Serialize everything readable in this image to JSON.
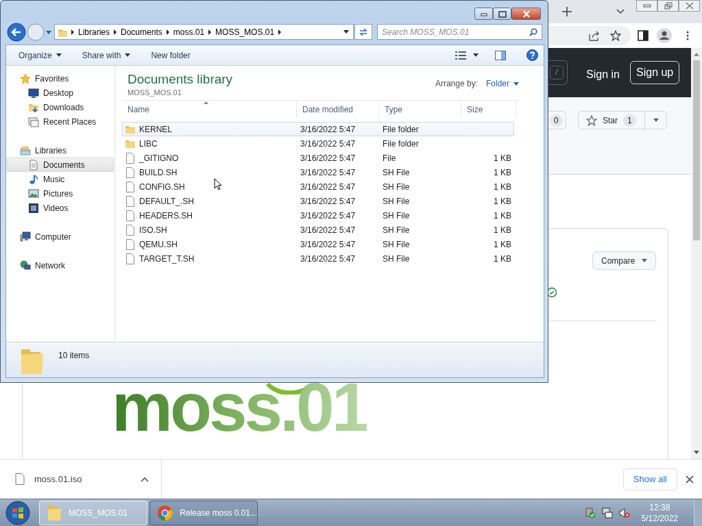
{
  "browser": {
    "header": {
      "slash_key": "/",
      "sign_in": "Sign in",
      "sign_up": "Sign up"
    },
    "watch_count": "0",
    "star_label": "Star",
    "star_count": "1",
    "compare": "Compare",
    "logo": "moss.01"
  },
  "explorer": {
    "address": [
      "Libraries",
      "Documents",
      "moss.01",
      "MOSS_MOS.01"
    ],
    "search_placeholder": "Search MOSS_MOS.01",
    "toolbar": [
      {
        "label": "Organize",
        "dropdown": true
      },
      {
        "label": "Share with",
        "dropdown": true
      },
      {
        "label": "New folder",
        "dropdown": false
      }
    ],
    "nav": [
      {
        "label": "Favorites",
        "selected": false,
        "children": [
          {
            "label": "Desktop",
            "selected": false
          },
          {
            "label": "Downloads",
            "selected": false
          },
          {
            "label": "Recent Places",
            "selected": false
          }
        ]
      },
      {
        "label": "Libraries",
        "selected": false,
        "children": [
          {
            "label": "Documents",
            "selected": true
          },
          {
            "label": "Music",
            "selected": false
          },
          {
            "label": "Pictures",
            "selected": false
          },
          {
            "label": "Videos",
            "selected": false
          }
        ]
      },
      {
        "label": "Computer",
        "selected": false
      },
      {
        "label": "Network",
        "selected": false
      }
    ],
    "library_title": "Documents library",
    "library_subtitle": "MOSS_MOS.01",
    "arrange_label": "Arrange by:",
    "arrange_value": "Folder",
    "columns": [
      "Name",
      "Date modified",
      "Type",
      "Size"
    ],
    "rows": [
      {
        "name": "KERNEL",
        "kind": "folder",
        "date": "3/16/2022 5:47",
        "type": "File folder",
        "selected": true
      },
      {
        "name": "LIBC",
        "kind": "folder",
        "date": "3/16/2022 5:47",
        "type": "File folder",
        "selected": false
      },
      {
        "name": "_GITIGNO",
        "kind": "file",
        "date": "3/16/2022 5:47",
        "type": "File",
        "size": "1 KB",
        "selected": false
      },
      {
        "name": "BUILD.SH",
        "kind": "file",
        "date": "3/16/2022 5:47",
        "type": "SH File",
        "size": "1 KB",
        "selected": false
      },
      {
        "name": "CONFIG.SH",
        "kind": "file",
        "date": "3/16/2022 5:47",
        "type": "SH File",
        "size": "1 KB",
        "selected": false
      },
      {
        "name": "DEFAULT_.SH",
        "kind": "file",
        "date": "3/16/2022 5:47",
        "type": "SH File",
        "size": "1 KB",
        "selected": false
      },
      {
        "name": "HEADERS.SH",
        "kind": "file",
        "date": "3/16/2022 5:47",
        "type": "SH File",
        "size": "1 KB",
        "selected": false
      },
      {
        "name": "ISO.SH",
        "kind": "file",
        "date": "3/16/2022 5:47",
        "type": "SH File",
        "size": "1 KB",
        "selected": false
      },
      {
        "name": "QEMU.SH",
        "kind": "file",
        "date": "3/16/2022 5:47",
        "type": "SH File",
        "size": "1 KB",
        "selected": false
      },
      {
        "name": "TARGET_T.SH",
        "kind": "file",
        "date": "3/16/2022 5:47",
        "type": "SH File",
        "size": "1 KB",
        "selected": false
      }
    ],
    "status": "10 items"
  },
  "download_bar": {
    "file": "moss.01.iso",
    "show_all": "Show all"
  },
  "taskbar": {
    "tasks": [
      {
        "label": "MOSS_MOS.01",
        "selected": true
      },
      {
        "label": "Release moss 0.01...",
        "selected": false
      }
    ],
    "time": "12:38",
    "date": "5/12/2022"
  }
}
